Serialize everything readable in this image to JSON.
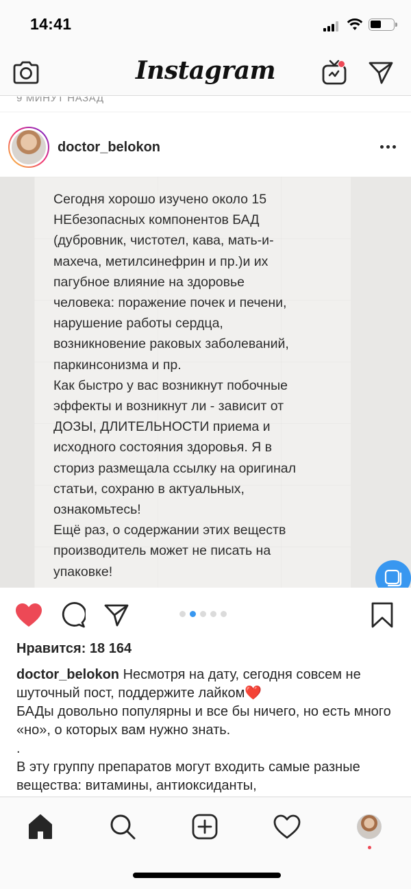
{
  "status_bar": {
    "time": "14:41",
    "icons": [
      "signal-icon",
      "wifi-icon",
      "battery-icon"
    ]
  },
  "header": {
    "logo": "Instagram",
    "icons": [
      "camera-icon",
      "igtv-icon",
      "direct-message-icon"
    ],
    "notification_color": "#ed4956"
  },
  "feed": {
    "prev_timestamp": "9 МИНУТ НАЗАД"
  },
  "post": {
    "username": "doctor_belokon",
    "image_text": "Сегодня хорошо изучено около 15\nНЕбезопасных компонентов БАД\n(дубровник, чистотел, кава, мать-и-\nмахеча, метилсинефрин и пр.)и их\nпагубное влияние на здоровье\nчеловека: поражение почек и печени,\nнарушение работы сердца,\nвозникновение раковых заболеваний,\nпаркинсонизма и пр.\nКак быстро у вас возникнут побочные\nэффекты и возникнут ли - зависит от\nДОЗЫ, ДЛИТЕЛЬНОСТИ приема и\nисходного состояния здоровья. Я в\nсториз размещала ссылку на оригинал\nстатьи, сохраню в актуальных,\nознакомьтесь!\nЕщё раз, о содержании этих веществ\nпроизводитель может не писать на\nупаковке!",
    "carousel": {
      "total": 5,
      "active_index": 1
    },
    "liked": true,
    "like_color": "#ed4956",
    "accent_color": "#3897f0",
    "likes_text": "Нравится: 18 164",
    "caption": {
      "username": "doctor_belokon",
      "line1": " Несмотря на дату, сегодня совсем не шуточный пост, поддержите лайком",
      "emoji": "❤️",
      "line2": "БАДы довольно популярны и все бы ничего, но есть много «но», о которых вам нужно знать.",
      "line3": ".",
      "line4": "В эту группу препаратов могут входить самые разные вещества: витамины, антиоксиданты,"
    }
  },
  "bottom_nav": {
    "items": [
      "home-icon",
      "search-icon",
      "new-post-icon",
      "activity-heart-icon",
      "profile-avatar"
    ],
    "active": "home-icon"
  }
}
